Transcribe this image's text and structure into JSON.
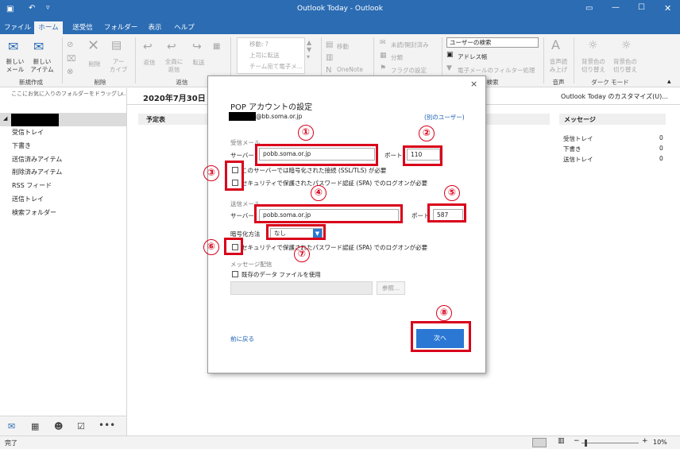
{
  "window": {
    "title": "Outlook Today - Outlook"
  },
  "ribbon_tabs": [
    "ファイル",
    "ホーム",
    "送受信",
    "フォルダー",
    "表示",
    "ヘルプ"
  ],
  "ribbon": {
    "new_mail": "新しい\nメール",
    "new_items": "新しい\nアイテム",
    "delete": "削除",
    "archive": "アー\nカイブ",
    "reply": "返信",
    "reply_all": "全員に\n返信",
    "forward": "転送",
    "move_to": "移動: ?",
    "to_manager": "上司に転送",
    "team_email": "チーム宛て電子メ...",
    "move": "移動",
    "onenote": "OneNote",
    "unread_read": "未読/開封済み",
    "categorize": "分類",
    "follow_up": "フラグの設定",
    "search_people": "ユーザーの検索",
    "address_book": "アドレス帳",
    "filter_email": "電子メールのフィルター処理",
    "read_aloud": "音声読\nみ上げ",
    "bg_color": "背景色の\n切り替え",
    "bg_color2": "背景色の\n切り替え",
    "groups": {
      "new": "新規作成",
      "delete": "削除",
      "respond": "返信",
      "find": "検索",
      "speech": "音声",
      "dark_mode": "ダーク モード"
    }
  },
  "left_pane": {
    "drag_hint": "ここにお気に入りのフォルダーをドラッグし...",
    "folders": [
      "受信トレイ",
      "下書き",
      "送信済みアイテム",
      "削除済みアイテム",
      "RSS フィード",
      "送信トレイ",
      "検索フォルダー"
    ]
  },
  "main": {
    "date": "2020年7月30日",
    "customize": "Outlook Today のカスタマイズ(U)...",
    "calendar_header": "予定表",
    "messages_header": "メッセージ",
    "messages": [
      {
        "name": "受信トレイ",
        "count": "0"
      },
      {
        "name": "下書き",
        "count": "0"
      },
      {
        "name": "送信トレイ",
        "count": "0"
      }
    ]
  },
  "dialog": {
    "title": "POP アカウントの設定",
    "email_domain": "@bb.soma.or.jp",
    "other_user": "(別のユーザー)",
    "incoming_label": "受信メール",
    "server_label": "サーバー",
    "incoming_server": "pobb.soma.or.jp",
    "port_label": "ポート",
    "incoming_port": "110",
    "ssl_text": "このサーバーでは暗号化された接続 (SSL/TLS) が必要",
    "spa_text": "セキュリティで保護されたパスワード認証 (SPA) でのログオンが必要",
    "outgoing_label": "送信メール",
    "outgoing_server": "pobb.soma.or.jp",
    "outgoing_port": "587",
    "encryption_label": "暗号化方法",
    "encryption_value": "なし",
    "spa_text2": "セキュリティで保護されたパスワード認証 (SPA) でのログオンが必要",
    "delivery_label": "メッセージ配信",
    "existing_data": "既存のデータ ファイルを使用",
    "browse": "参照...",
    "back": "前に戻る",
    "next": "次へ",
    "close": "×"
  },
  "annotations": [
    "①",
    "②",
    "③",
    "④",
    "⑤",
    "⑥",
    "⑦",
    "⑧"
  ],
  "status": {
    "left": "完了",
    "zoom": "10%"
  },
  "colors": {
    "accent": "#2b6cb3",
    "annotation": "#d9001b",
    "next_button": "#2b78d4"
  }
}
